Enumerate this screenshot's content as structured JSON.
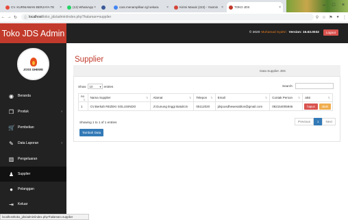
{
  "browser": {
    "tabs": [
      {
        "label": "CV. KURNIAWAN BERJAYA TE",
        "color": "#e74c3c"
      },
      {
        "label": "(13) WhatsApp",
        "color": "#25d366"
      },
      {
        "label": "",
        "color": "#3b5998"
      },
      {
        "label": "cara menampilkan tgl sekara",
        "color": "#4285f4"
      },
      {
        "label": "Kirimi Masuk (223) - Yasmin",
        "color": "#d44638"
      },
      {
        "label": "TOKO JDS",
        "color": "#c0392b"
      }
    ],
    "url_host": "localhost",
    "url_path": "/toko_jds/admin/index.php?halaman=supplier",
    "status_url": "localhost/toko_jds/admin/index.php?halaman=supplier"
  },
  "header": {
    "brand": "Toko JDS Admin",
    "copyright": "© 2020",
    "author": "Muhamad Syahri",
    "version_label": "Version: 16.63.0032",
    "logout_label": "Logout"
  },
  "sidebar": {
    "logo_text": "JOSS GHEWE",
    "items": [
      {
        "label": "Beranda",
        "icon": "dashboard-icon",
        "glyph": "◉",
        "caret": ""
      },
      {
        "label": "Produk",
        "icon": "box-icon",
        "glyph": "❒",
        "caret": "‹"
      },
      {
        "label": "Pembelian",
        "icon": "cart-icon",
        "glyph": "🛒",
        "caret": ""
      },
      {
        "label": "Data Laporan",
        "icon": "report-icon",
        "glyph": "✎",
        "caret": "‹"
      },
      {
        "label": "Pengeluaran",
        "icon": "chart-icon",
        "glyph": "▥",
        "caret": ""
      },
      {
        "label": "Supplier",
        "icon": "supplier-icon",
        "glyph": "♟",
        "caret": ""
      },
      {
        "label": "Pelanggan",
        "icon": "user-icon",
        "glyph": "●",
        "caret": ""
      },
      {
        "label": "Keluar",
        "icon": "logout-icon",
        "glyph": "⇥",
        "caret": ""
      }
    ]
  },
  "main": {
    "title": "Supplier",
    "panel_heading": "Data Supplier JDS",
    "show_label": "Show",
    "entries_value": "10",
    "entries_label": "entries",
    "search_label": "Search:",
    "columns": [
      "no",
      "Nama Supplier",
      "Alamat",
      "Telepon",
      "Email",
      "Contak Person",
      "aksi"
    ],
    "rows": [
      {
        "no": "1",
        "nama": "CV.Berkah REZEKI SOLUSINDO",
        "alamat": "Jl.Gunung tinggi Batulicin",
        "telepon": "05112020",
        "email": "jdsjoosdhewesablon@gmail.com",
        "contak": "082154005946"
      }
    ],
    "hapus_label": "hapus",
    "ubah_label": "ubah",
    "info": "Showing 1 to 1 of 1 entries",
    "previous_label": "Previous",
    "page": "1",
    "next_label": "Next",
    "add_label": "Tambah Data"
  }
}
